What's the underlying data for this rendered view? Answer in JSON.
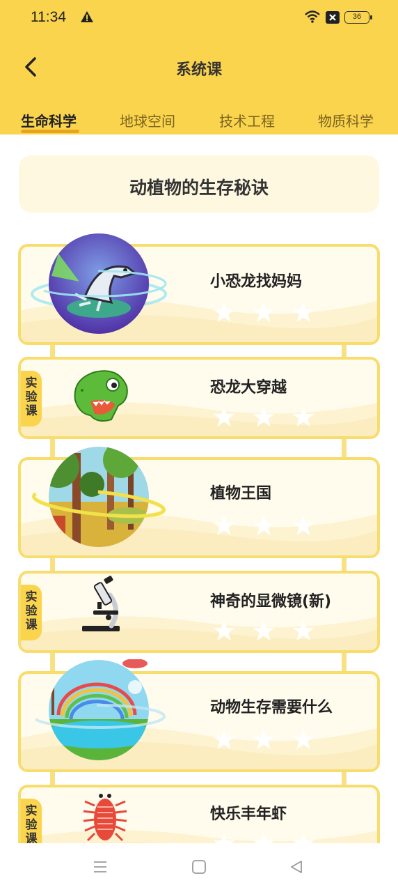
{
  "status_bar": {
    "time": "11:34",
    "battery": "36",
    "icons": [
      "warning-icon",
      "wifi-icon",
      "close-box-icon",
      "battery-icon"
    ]
  },
  "header": {
    "title": "系统课",
    "back_icon": "chevron-left-icon"
  },
  "tabs": [
    {
      "label": "生命科学",
      "active": true
    },
    {
      "label": "地球空间",
      "active": false
    },
    {
      "label": "技术工程",
      "active": false
    },
    {
      "label": "物质科学",
      "active": false
    }
  ],
  "section": {
    "title": "动植物的生存秘诀"
  },
  "lessons": [
    {
      "title": "小恐龙找妈妈",
      "type": "planet",
      "image": "dinosaur-skeleton-planet",
      "stars": 3
    },
    {
      "title": "恐龙大穿越",
      "type": "lab",
      "badge": "实验课",
      "image": "green-dinosaur-head",
      "stars": 3
    },
    {
      "title": "植物王国",
      "type": "planet",
      "image": "forest-planet",
      "stars": 3
    },
    {
      "title": "神奇的显微镜(新)",
      "type": "lab",
      "badge": "实验课",
      "image": "microscope",
      "stars": 3
    },
    {
      "title": "动物生存需要什么",
      "type": "planet",
      "image": "rainbow-lake-planet",
      "stars": 3
    },
    {
      "title": "快乐丰年虾",
      "type": "lab",
      "badge": "实验课",
      "image": "fairy-shrimp",
      "stars": 3
    }
  ],
  "nav_bar": {
    "icons": [
      "menu-icon",
      "home-square-icon",
      "back-triangle-icon"
    ]
  },
  "colors": {
    "brand_yellow": "#FBD44E",
    "card_border": "#F7DD6E",
    "star": "#ffffff",
    "underline": "#E8A51C"
  }
}
